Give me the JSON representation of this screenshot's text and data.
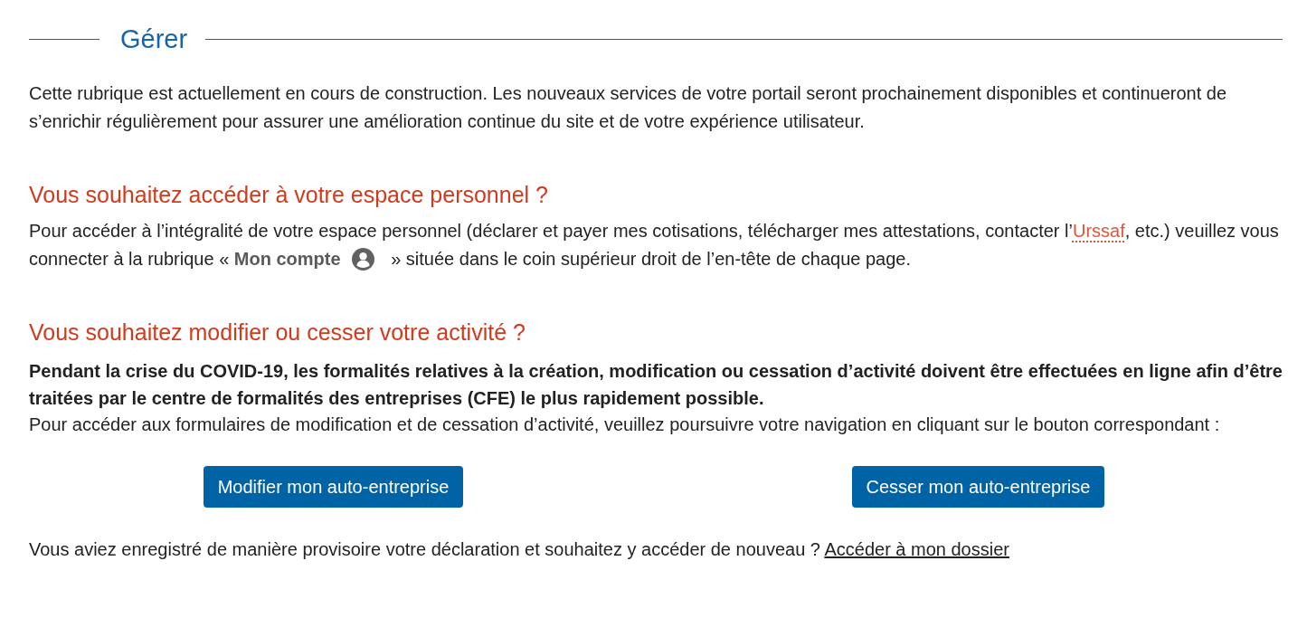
{
  "section": {
    "title": "Gérer"
  },
  "intro": "Cette rubrique est actuellement en cours de construction. Les nouveaux services de votre portail seront prochainement disponibles et continueront de s’enrichir régulièrement pour assurer une amélioration continue du site et de votre expérience utilisateur.",
  "blocks": [
    {
      "kind": "info",
      "heading": "Vous souhaitez accéder à votre espace personnel ?",
      "parts": [
        {
          "kind": "text",
          "text": "Pour accéder à l’intégralité de votre espace personnel (déclarer et payer mes cotisations, télécharger mes attestations, contacter l’"
        },
        {
          "kind": "link",
          "text": "Urssaf"
        },
        {
          "kind": "text",
          "text": ", etc.) veuillez vous connecter à la rubrique « "
        },
        {
          "kind": "strong",
          "text": "Mon compte",
          "icon": true
        },
        {
          "kind": "text",
          "text": " » située dans le coin supérieur droit de l’en-tête de chaque page."
        }
      ]
    },
    {
      "kind": "actions",
      "heading": "Vous souhaitez modifier ou cesser votre activité ?",
      "notice": "Pendant la crise du COVID-19, les formalités relatives à la création, modification ou cessation d’activité doivent être effectuées en ligne afin d’être traitées par le centre de formalités des entreprises (CFE) le plus rapidement possible.",
      "text": "Pour accéder aux formulaires de modification et de cessation d’activité, veuillez poursuivre votre navigation en cliquant sur le bouton correspondant :",
      "buttons": [
        "Modifier mon auto-entreprise",
        "Cesser mon auto-entreprise"
      ],
      "footer": {
        "text": "Vous aviez enregistré de manière provisoire votre déclaration et souhaitez y accéder de nouveau ?",
        "link": "Accéder à mon dossier"
      }
    }
  ]
}
